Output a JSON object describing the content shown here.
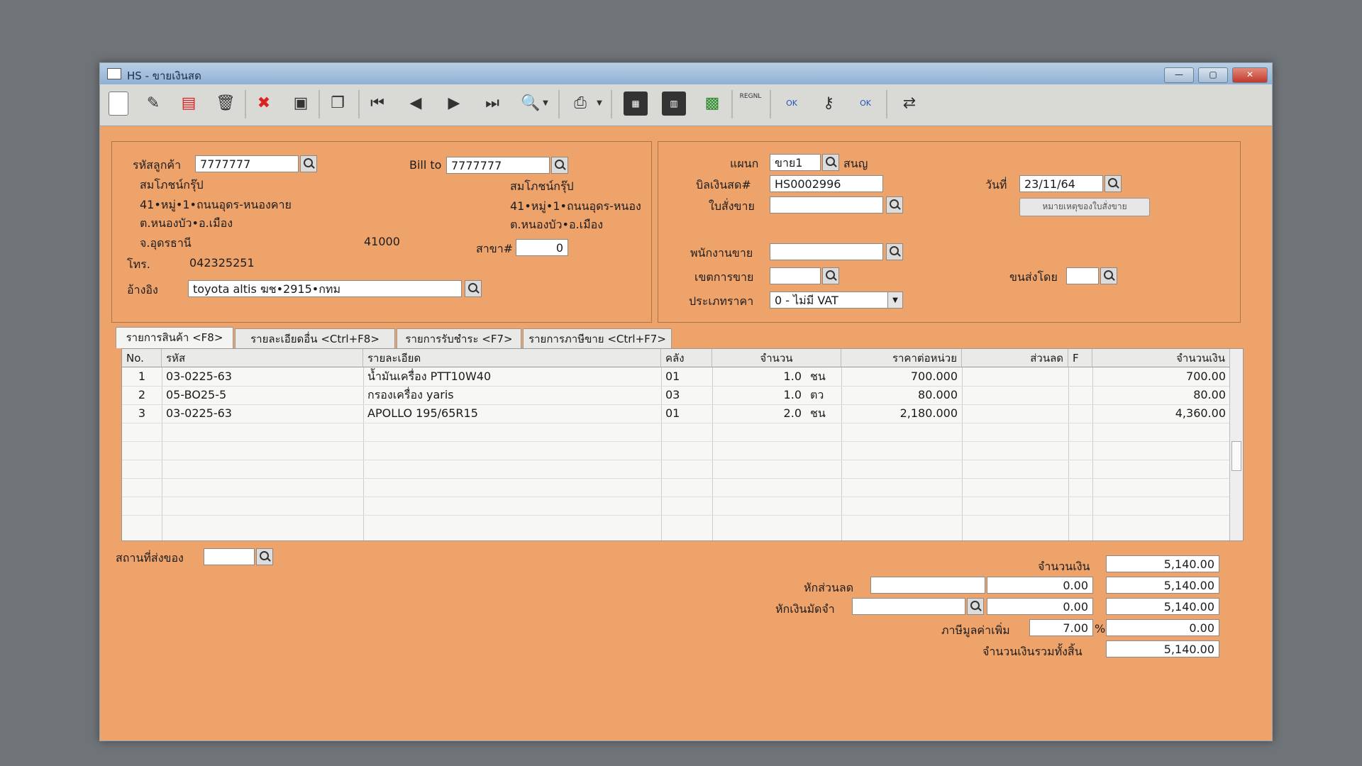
{
  "window": {
    "title": "HS - ขายเงินสด",
    "min": "—",
    "max": "▢",
    "close": "✕"
  },
  "toolbar": {
    "report_label": "REGNL",
    "ok_label": "OK"
  },
  "customer": {
    "code_label": "รหัสลูกค้า",
    "code": "7777777",
    "name": "สมโภชน์กรุ๊ป",
    "address1": "41•หมู่•1•ถนนอุดร-หนองคาย",
    "address2": "ต.หนองบัว•อ.เมือง",
    "province": "จ.อุดรธานี",
    "postcode": "41000",
    "phone_label": "โทร.",
    "phone": "042325251",
    "ref_label": "อ้างอิง",
    "ref": "toyota altis ฆช•2915•กทม"
  },
  "billto": {
    "label": "Bill to",
    "code": "7777777",
    "name": "สมโภชน์กรุ๊ป",
    "address1": "41•หมู่•1•ถนนอุดร-หนอง",
    "address2": "ต.หนองบัว•อ.เมือง",
    "branch_label": "สาขา#",
    "branch": "0"
  },
  "doc": {
    "dept_label": "แผนก",
    "dept": "ขาย1",
    "dept_name": "สนญ",
    "bill_label": "บิลเงินสด#",
    "bill": "HS0002996",
    "date_label": "วันที่",
    "date": "23/11/64",
    "order_label": "ใบสั่งขาย",
    "order": "",
    "note_button": "หมายเหตุของใบสั่งขาย",
    "salesman_label": "พนักงานขาย",
    "salesman": "",
    "area_label": "เขตการขาย",
    "area": "",
    "ship_label": "ขนส่งโดย",
    "ship": "",
    "price_type_label": "ประเภทราคา",
    "price_type": "0 - ไม่มี VAT"
  },
  "tabs": [
    {
      "label": "รายการสินค้า <F8>"
    },
    {
      "label": "รายละเอียดอื่น <Ctrl+F8>"
    },
    {
      "label": "รายการรับชำระ <F7>"
    },
    {
      "label": "รายการภาษีขาย <Ctrl+F7>"
    }
  ],
  "table": {
    "headers": {
      "no": "No.",
      "code": "รหัส",
      "desc": "รายละเอียด",
      "wh": "คลัง",
      "qty": "จำนวน",
      "price": "ราคาต่อหน่วย",
      "disc": "ส่วนลด",
      "f": "F",
      "amount": "จำนวนเงิน"
    },
    "rows": [
      {
        "no": "1",
        "code": "03-0225-63",
        "desc": "น้ำมันเครื่อง PTT10W40",
        "wh": "01",
        "qty": "1.0",
        "unit": "ชน",
        "price": "700.000",
        "disc": "",
        "amount": "700.00"
      },
      {
        "no": "2",
        "code": "05-BO25-5",
        "desc": "กรองเครื่อง yaris",
        "wh": "03",
        "qty": "1.0",
        "unit": "ตว",
        "price": "80.000",
        "disc": "",
        "amount": "80.00"
      },
      {
        "no": "3",
        "code": "03-0225-63",
        "desc": "APOLLO 195/65R15",
        "wh": "01",
        "qty": "2.0",
        "unit": "ชน",
        "price": "2,180.000",
        "disc": "",
        "amount": "4,360.00"
      }
    ]
  },
  "footer": {
    "delivery_label": "สถานที่ส่งของ",
    "delivery": "",
    "amount_label": "จำนวนเงิน",
    "amount": "5,140.00",
    "discount_label": "หักส่วนลด",
    "discount_input": "",
    "discount_value": "0.00",
    "after_discount": "5,140.00",
    "deposit_label": "หักเงินมัดจำ",
    "deposit_input": "",
    "deposit_value": "0.00",
    "after_deposit": "5,140.00",
    "vat_label": "ภาษีมูลค่าเพิ่ม",
    "vat_rate": "7.00",
    "vat_pct": "%",
    "vat_amount": "0.00",
    "total_label": "จำนวนเงินรวมทั้งสิ้น",
    "total": "5,140.00"
  }
}
